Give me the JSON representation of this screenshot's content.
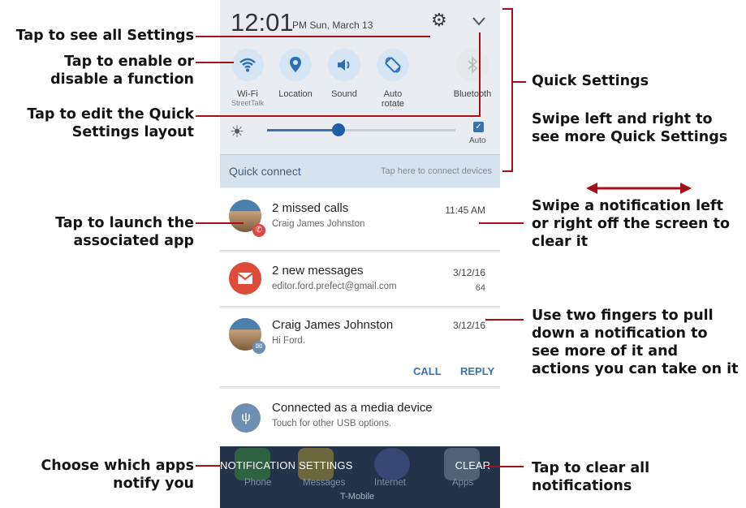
{
  "status_bar": {
    "time": "12:01",
    "date": "PM Sun, March 13"
  },
  "quick_settings": [
    {
      "label": "Wi-Fi",
      "sub": "StreetTalk",
      "icon": "wifi-icon"
    },
    {
      "label": "Location",
      "sub": "",
      "icon": "location-icon"
    },
    {
      "label": "Sound",
      "sub": "",
      "icon": "sound-icon"
    },
    {
      "label": "Auto rotate",
      "sub": "",
      "icon": "auto-rotate-icon"
    },
    {
      "label": "Bluetooth",
      "sub": "",
      "icon": "bluetooth-icon"
    }
  ],
  "brightness": {
    "auto_label": "Auto",
    "level": 0.38,
    "auto_checked": true
  },
  "quick_connect": {
    "title": "Quick connect",
    "hint": "Tap here to connect devices"
  },
  "notifications": [
    {
      "title": "2 missed calls",
      "sub": "Craig James Johnston",
      "time": "11:45 AM",
      "count": ""
    },
    {
      "title": "2 new messages",
      "sub": "editor.ford.prefect@gmail.com",
      "time": "3/12/16",
      "count": "64"
    },
    {
      "title": "Craig James Johnston",
      "sub": "Hi Ford.",
      "time": "3/12/16",
      "count": ""
    },
    {
      "title": "Connected as a media device",
      "sub": "Touch for other USB options.",
      "time": "",
      "count": ""
    }
  ],
  "actions": {
    "call": "CALL",
    "reply": "REPLY"
  },
  "bottom_bar": {
    "settings": "NOTIFICATION SETTINGS",
    "clear": "CLEAR",
    "apps": [
      "Phone",
      "Messages",
      "Internet",
      "Apps"
    ],
    "carrier": "T-Mobile"
  },
  "callouts": {
    "left": [
      "Tap to see all Settings",
      "Tap to enable or disable a function",
      "Tap to edit the Quick Settings layout",
      "Tap to launch the associated app",
      "Choose which apps notify you"
    ],
    "right": [
      "Quick Settings",
      "Swipe left and right to see more Quick Settings",
      "Swipe a notification left or right off the screen to clear it",
      "Use two fingers to pull down a notification to see more of it and actions you can take on it",
      "Tap to clear all notifications"
    ]
  },
  "colors": {
    "accent": "#3a72b0",
    "callout_line": "#a3101a",
    "panel_bg": "#e9edf1",
    "bottom_bar": "#233349",
    "gmail_red": "#dd4b39"
  }
}
